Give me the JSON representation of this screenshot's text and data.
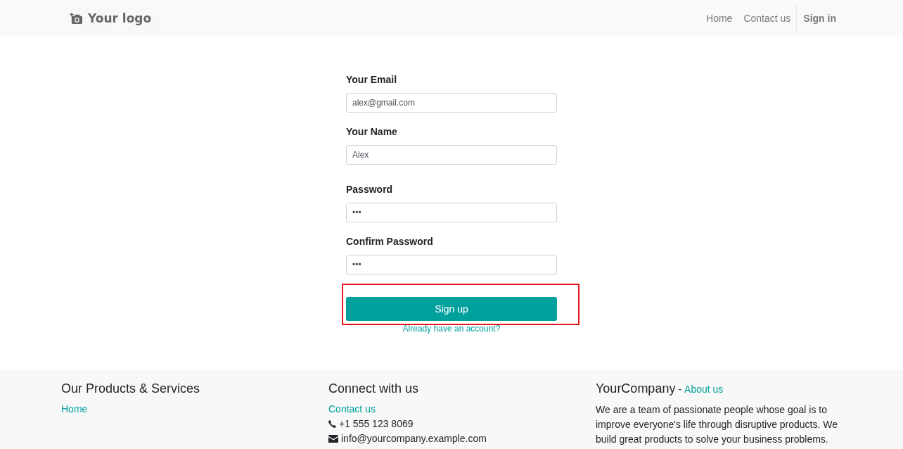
{
  "navbar": {
    "logo": "Your logo",
    "links": [
      {
        "label": "Home"
      },
      {
        "label": "Contact us"
      }
    ],
    "sign_in": "Sign in"
  },
  "form": {
    "field_groups": [
      {
        "fields": [
          {
            "label": "Your Email",
            "value": "alex@gmail.com"
          },
          {
            "label": "Your Name",
            "value": "Alex"
          }
        ]
      },
      {
        "fields": [
          {
            "label": "Password",
            "value": "•••"
          },
          {
            "label": "Confirm Password",
            "value": "•••"
          }
        ]
      }
    ],
    "submit": {
      "label": "Sign up",
      "highlighted": true
    },
    "login_link": "Already have an account?"
  },
  "footer": {
    "products": {
      "title": "Our Products & Services",
      "links": [
        "Home"
      ]
    },
    "connect": {
      "title": "Connect with us",
      "links": [
        "Contact us"
      ],
      "contacts": [
        {
          "kind": "phone",
          "text": "+1 555 123 8069"
        },
        {
          "kind": "email",
          "text": "info@yourcompany.example.com"
        }
      ]
    },
    "about": {
      "title": "YourCompany",
      "separator": "-",
      "link": "About us",
      "text": "We are a team of passionate people whose goal is to improve everyone's life through disruptive products. We build great products to solve your business problems."
    }
  }
}
